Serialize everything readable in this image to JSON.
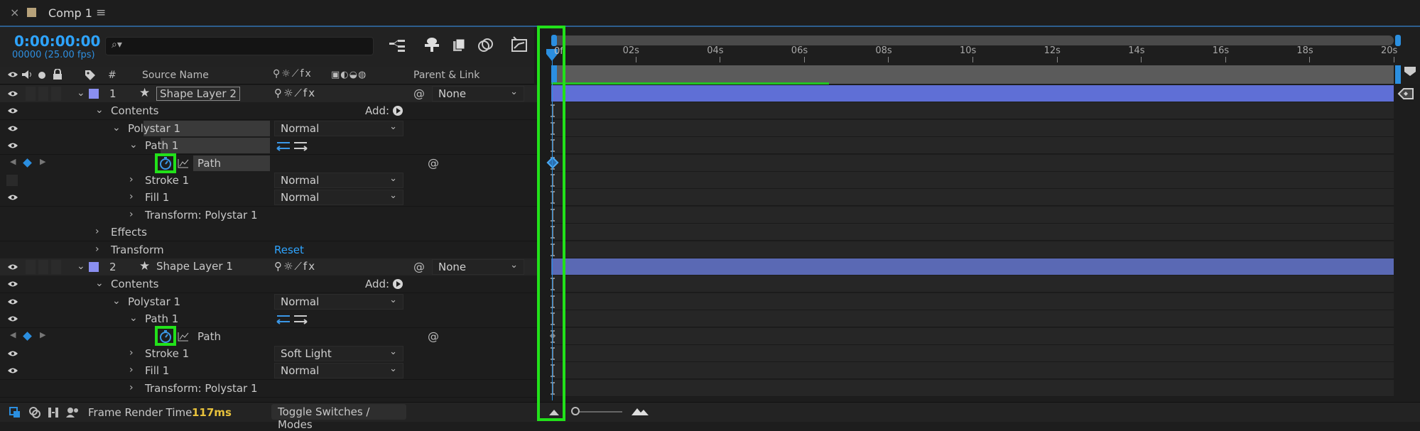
{
  "panel": {
    "close_glyph": "×",
    "title": "Comp 1",
    "menu_glyph": "≡"
  },
  "timecode": {
    "value": "0:00:00:00",
    "frames": "00000 (25.00 fps)"
  },
  "search": {
    "placeholder": "⌕▾"
  },
  "columns": {
    "hash": "#",
    "source_name": "Source Name",
    "parent_link": "Parent & Link"
  },
  "switch_icons_layer": "⚲☼⟋fx",
  "add_label": "Add:",
  "rows": [
    {
      "kind": "layer",
      "num": "1",
      "name": "Shape Layer 2",
      "parent": "None",
      "selected": true
    },
    {
      "kind": "prop",
      "label": "Contents",
      "level": 1,
      "add": true
    },
    {
      "kind": "prop",
      "label": "Polystar 1",
      "level": 2,
      "dropdown": "Normal",
      "highlight": true
    },
    {
      "kind": "prop",
      "label": "Path 1",
      "level": 3,
      "pathicons": true,
      "highlight": true
    },
    {
      "kind": "path",
      "label": "Path",
      "highlight": true,
      "keyframe": true
    },
    {
      "kind": "prop",
      "label": "Stroke 1",
      "level": 3,
      "collapsed": true,
      "dropdown": "Normal",
      "noeye": true
    },
    {
      "kind": "prop",
      "label": "Fill 1",
      "level": 3,
      "collapsed": true,
      "dropdown": "Normal"
    },
    {
      "kind": "prop",
      "label": "Transform: Polystar 1",
      "level": 3,
      "collapsed": true,
      "noeye": true
    },
    {
      "kind": "prop",
      "label": "Effects",
      "level": 1,
      "collapsed": true,
      "noeye": true
    },
    {
      "kind": "prop",
      "label": "Transform",
      "level": 1,
      "collapsed": true,
      "reset": "Reset",
      "noeye": true
    },
    {
      "kind": "layer",
      "num": "2",
      "name": "Shape Layer 1",
      "parent": "None",
      "selected": false
    },
    {
      "kind": "prop",
      "label": "Contents",
      "level": 1,
      "add": true
    },
    {
      "kind": "prop",
      "label": "Polystar 1",
      "level": 2,
      "dropdown": "Normal"
    },
    {
      "kind": "prop",
      "label": "Path 1",
      "level": 3,
      "pathicons": true
    },
    {
      "kind": "path",
      "label": "Path",
      "keyframe": false
    },
    {
      "kind": "prop",
      "label": "Stroke 1",
      "level": 3,
      "collapsed": true,
      "dropdown": "Soft Light"
    },
    {
      "kind": "prop",
      "label": "Fill 1",
      "level": 3,
      "collapsed": true,
      "dropdown": "Normal"
    },
    {
      "kind": "prop",
      "label": "Transform: Polystar 1",
      "level": 3,
      "collapsed": true,
      "noeye": true
    }
  ],
  "footer": {
    "frame_render_label": "Frame Render Time",
    "frame_render_value": "117ms",
    "toggle_label": "Toggle Switches / Modes"
  },
  "timeline": {
    "start_label": "0f",
    "ticks": [
      "02s",
      "04s",
      "06s",
      "08s",
      "10s",
      "12s",
      "14s",
      "16s",
      "18s",
      "20s"
    ],
    "duration_s": 20,
    "work_area_progress": 0.33
  },
  "colors": {
    "accent_blue": "#2b8fe0",
    "timecode_blue": "#2ea4ff",
    "label_purple": "#8a8ff0",
    "bar_blue": "#5f6fd6",
    "bar_blue2": "#5a69b4",
    "highlight_green": "#22e11a",
    "render_yellow": "#e8c23c"
  }
}
